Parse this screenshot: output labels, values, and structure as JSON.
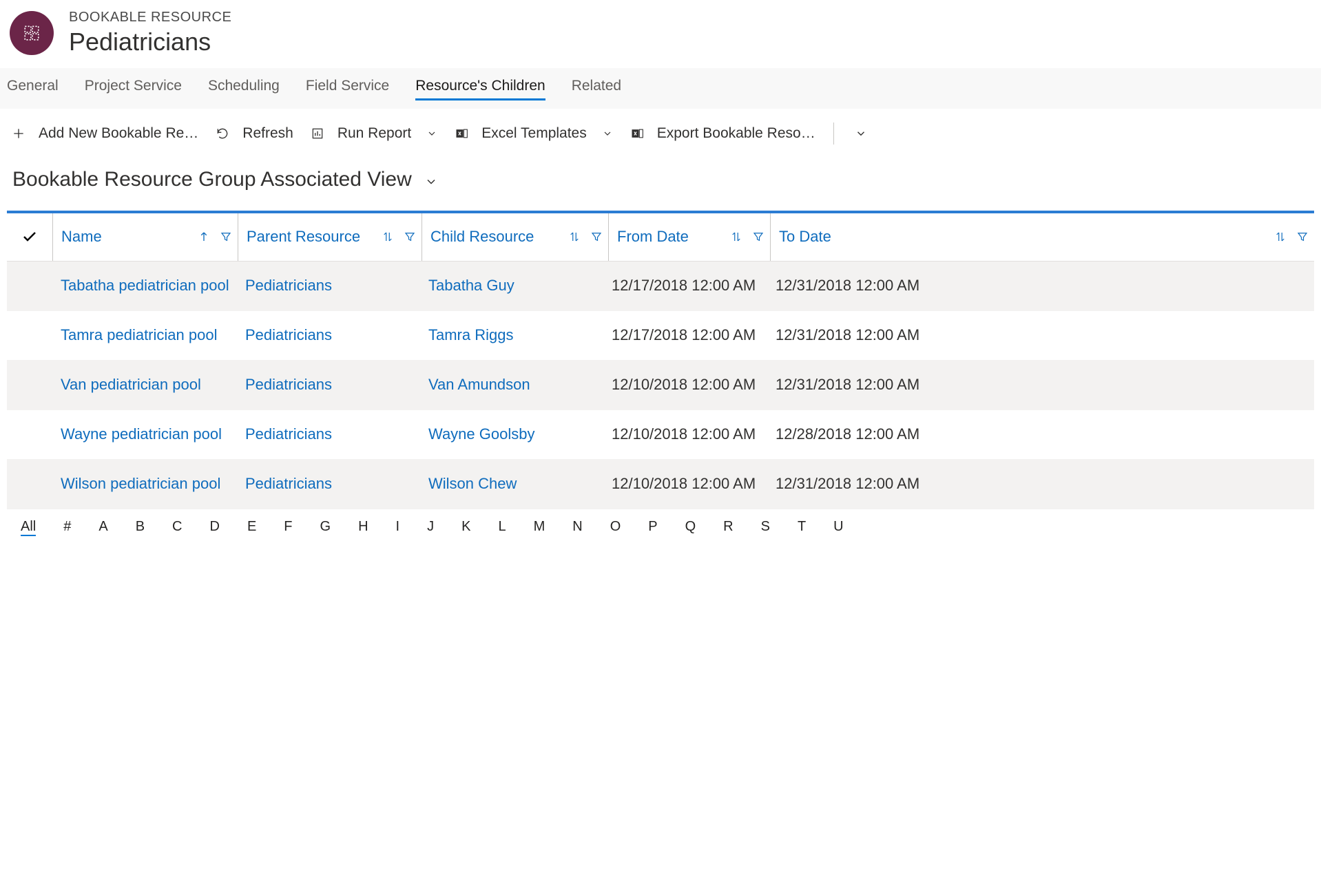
{
  "header": {
    "entity_label": "BOOKABLE RESOURCE",
    "record_name": "Pediatricians"
  },
  "tabs": [
    {
      "label": "General",
      "active": false
    },
    {
      "label": "Project Service",
      "active": false
    },
    {
      "label": "Scheduling",
      "active": false
    },
    {
      "label": "Field Service",
      "active": false
    },
    {
      "label": "Resource's Children",
      "active": true
    },
    {
      "label": "Related",
      "active": false
    }
  ],
  "commands": {
    "add_new": "Add New Bookable Re…",
    "refresh": "Refresh",
    "run_report": "Run Report",
    "excel_templates": "Excel Templates",
    "export": "Export Bookable Reso…"
  },
  "view": {
    "title": "Bookable Resource Group Associated View"
  },
  "grid": {
    "columns": {
      "name": "Name",
      "parent": "Parent Resource",
      "child": "Child Resource",
      "from": "From Date",
      "to": "To Date"
    },
    "rows": [
      {
        "name": "Tabatha pediatrician pool",
        "parent": "Pediatricians",
        "child": "Tabatha Guy",
        "from": "12/17/2018 12:00 AM",
        "to": "12/31/2018 12:00 AM"
      },
      {
        "name": "Tamra pediatrician pool",
        "parent": "Pediatricians",
        "child": "Tamra Riggs",
        "from": "12/17/2018 12:00 AM",
        "to": "12/31/2018 12:00 AM"
      },
      {
        "name": "Van pediatrician pool",
        "parent": "Pediatricians",
        "child": "Van Amundson",
        "from": "12/10/2018 12:00 AM",
        "to": "12/31/2018 12:00 AM"
      },
      {
        "name": "Wayne pediatrician pool",
        "parent": "Pediatricians",
        "child": "Wayne Goolsby",
        "from": "12/10/2018 12:00 AM",
        "to": "12/28/2018 12:00 AM"
      },
      {
        "name": "Wilson pediatrician pool",
        "parent": "Pediatricians",
        "child": "Wilson Chew",
        "from": "12/10/2018 12:00 AM",
        "to": "12/31/2018 12:00 AM"
      }
    ]
  },
  "jump": {
    "all": "All",
    "letters": [
      "#",
      "A",
      "B",
      "C",
      "D",
      "E",
      "F",
      "G",
      "H",
      "I",
      "J",
      "K",
      "L",
      "M",
      "N",
      "O",
      "P",
      "Q",
      "R",
      "S",
      "T",
      "U"
    ]
  }
}
